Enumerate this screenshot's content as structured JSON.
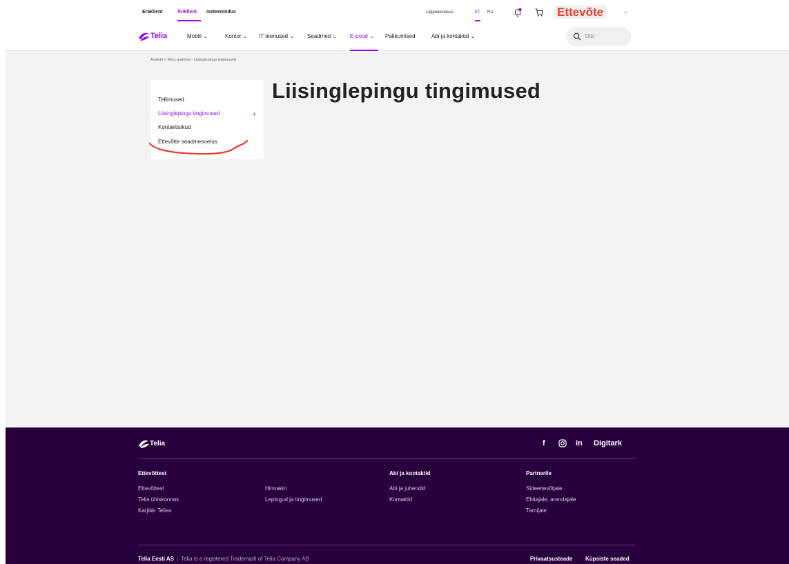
{
  "utility_bar": {
    "segments": [
      "Eraklient",
      "Äriklient",
      "Iseteenindus"
    ],
    "active_segment": "Äriklient",
    "accessibility": "Ligipääsetavus",
    "languages": [
      "ET",
      "RU"
    ],
    "active_language": "ET",
    "business_label": "Ettevõte"
  },
  "nav": {
    "logo_text": "Telia",
    "items": [
      "Mobiil",
      "Kontor",
      "IT teenused",
      "Seadmed",
      "E-pood",
      "Pakkumised",
      "Abi ja kontaktid"
    ],
    "active_item": "E-pood",
    "search_placeholder": "Otsi"
  },
  "breadcrumb": "Avaleht  >  Minu andmed - Liisinglepingu tingimused",
  "sidebar": {
    "items": [
      "Tellimused",
      "Liisinglepingu tingimused",
      "Kontaktisikud",
      "Ettevõtte seadmesoetus"
    ],
    "active_item": "Liisinglepingu tingimused"
  },
  "page_title": "Liisinglepingu tingimused",
  "footer": {
    "logo_text": "Telia",
    "social": [
      "f",
      "in",
      "Digitark"
    ],
    "columns": [
      {
        "heading": "Ettevõttest",
        "links": [
          "Ettevõttest",
          "Telia ühiskonnas",
          "Karjäär Telias"
        ]
      },
      {
        "heading": "",
        "links": [
          "Hinnakiri",
          "Lepingud ja tingimused"
        ]
      },
      {
        "heading": "Abi ja kontaktid",
        "links": [
          "Abi ja juhendid",
          "Kontaktid"
        ]
      },
      {
        "heading": "Partnerile",
        "links": [
          "Sideettevõtjale",
          "Ehitajale, arendajale",
          "Tarnijale"
        ]
      }
    ],
    "company": "Telia Eesti AS",
    "trademark": "Telia is a registered Trademark of Telia Company AB",
    "legal_links": [
      "Privaatsusteade",
      "Küpsiste seaded"
    ]
  },
  "colors": {
    "brand_purple": "#990ae3",
    "footer_bg": "#29003e",
    "annotation_red": "#e63b2e"
  }
}
